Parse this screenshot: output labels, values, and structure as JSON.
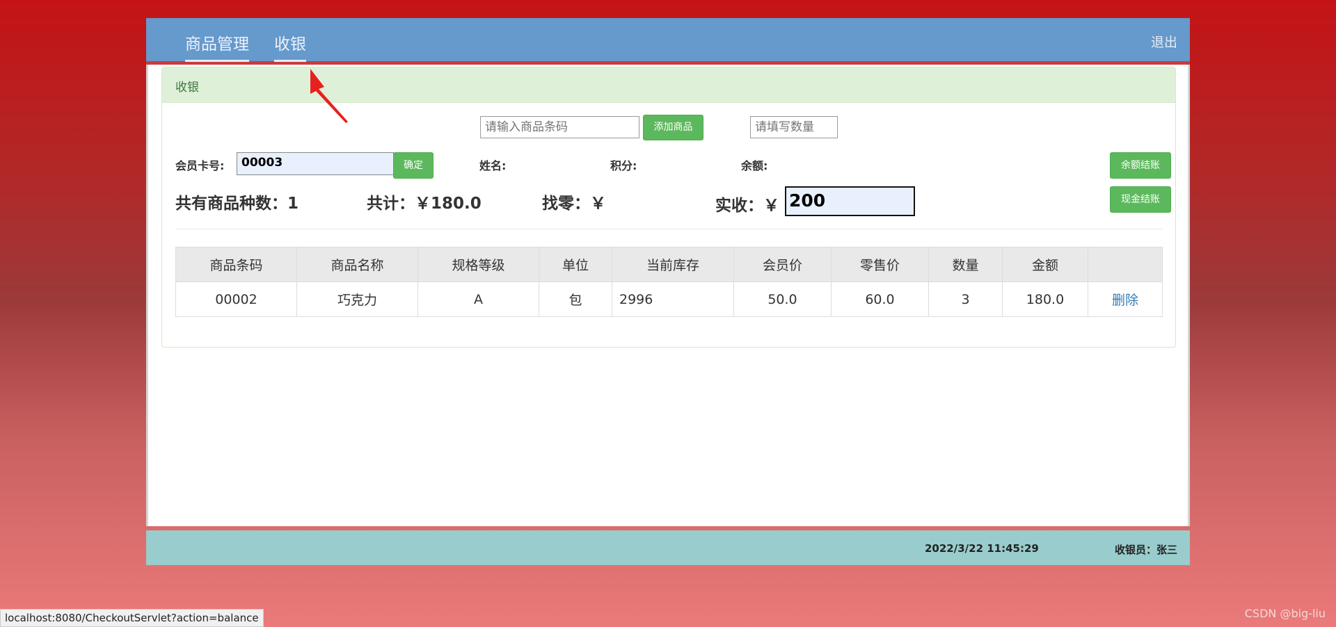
{
  "nav": {
    "tabs": [
      {
        "label": "商品管理"
      },
      {
        "label": "收银"
      }
    ],
    "logout": "退出"
  },
  "panel": {
    "title": "收银"
  },
  "barcode": {
    "placeholder": "请输入商品条码",
    "add_button": "添加商品"
  },
  "quantity": {
    "placeholder": "请填写数量"
  },
  "member": {
    "card_label": "会员卡号:",
    "card_value": "00003",
    "confirm_button": "确定",
    "name_label": "姓名:",
    "points_label": "积分:",
    "balance_label": "余额:",
    "balance_pay_button": "余额结账"
  },
  "summary": {
    "kinds_label": "共有商品种数：",
    "kinds_value": "1",
    "total_label": "共计：",
    "total_value": "￥180.0",
    "change_label": "找零：",
    "change_value": "￥",
    "received_label": "实收：",
    "received_currency": "￥",
    "received_value": "200",
    "cash_pay_button": "现金结账"
  },
  "table": {
    "headers": [
      "商品条码",
      "商品名称",
      "规格等级",
      "单位",
      "当前库存",
      "会员价",
      "零售价",
      "数量",
      "金额",
      ""
    ],
    "rows": [
      {
        "barcode": "00002",
        "name": "巧克力",
        "grade": "A",
        "unit": "包",
        "stock": "2996",
        "member_price": "50.0",
        "retail_price": "60.0",
        "qty": "3",
        "amount": "180.0",
        "action": "删除"
      }
    ]
  },
  "footer": {
    "datetime": "2022/3/22 11:45:29",
    "cashier": "收银员：张三"
  },
  "statusbar": {
    "url": "localhost:8080/CheckoutServlet?action=balance"
  },
  "watermark": "CSDN @big-liu",
  "colors": {
    "navbar": "#6699cc",
    "green": "#5cb85c",
    "footer": "#99cccc",
    "panel_head": "#dff0d8"
  }
}
